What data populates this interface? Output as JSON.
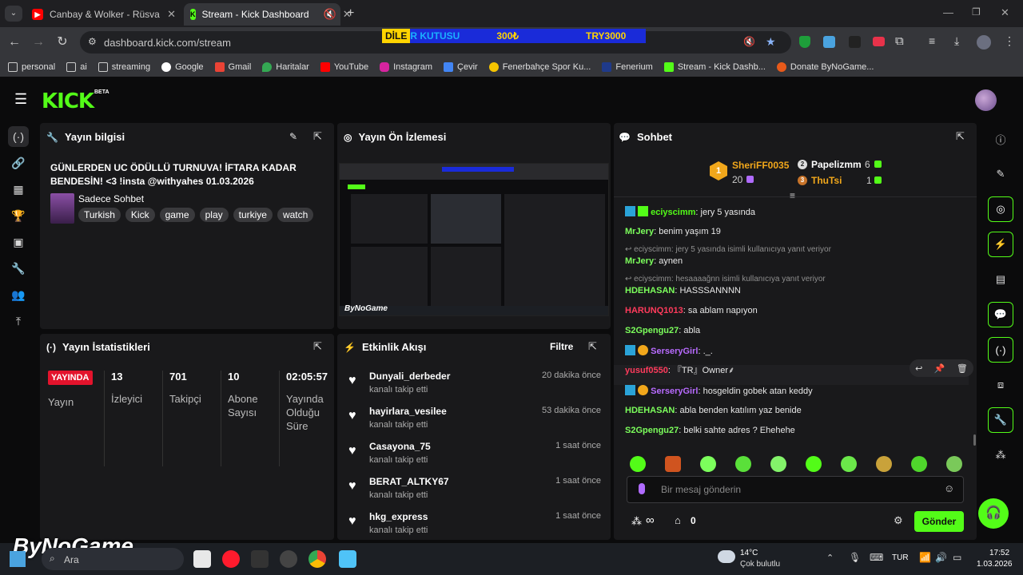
{
  "browser": {
    "tabs": [
      {
        "label": "Canbay & Wolker - Rüsva (Offic",
        "favicon_color": "#ff0000"
      },
      {
        "label": "Stream - Kick Dashboard",
        "favicon_color": "#53fc18"
      }
    ],
    "url": "dashboard.kick.com/stream",
    "banner": {
      "y_text": "DİLE",
      "rest": "R KUTUSU",
      "amount": "300₺",
      "currency": "TRY3000"
    },
    "bookmarks": [
      "personal",
      "ai",
      "streaming",
      "Google",
      "Gmail",
      "Haritalar",
      "YouTube",
      "Instagram",
      "Çevir",
      "Fenerbahçe Spor Ku...",
      "Fenerium",
      "Stream - Kick Dashb...",
      "Donate ByNoGame..."
    ]
  },
  "app": {
    "logo": "KICK",
    "beta": "BETA"
  },
  "stream_info": {
    "title": "Yayın bilgisi",
    "stream_title": "GÜNLERDEN UC ÖDÜLLÜ TURNUVA! İFTARA KADAR BENDESİN! <3 !insta @withyahes 01.03.2026",
    "category": "Sadece Sohbet",
    "tags": [
      "Turkish",
      "Kick",
      "game",
      "play",
      "turkiye",
      "watch"
    ]
  },
  "preview": {
    "title": "Yayın Ön İzlemesi",
    "watermark": "ByNoGame"
  },
  "chat": {
    "title": "Sohbet",
    "leaderboard": [
      {
        "rank": "1",
        "name": "SheriFF0035",
        "count": "20"
      },
      {
        "rank": "2",
        "name": "Papelizmm",
        "count": "6"
      },
      {
        "rank": "3",
        "name": "ThuTsi",
        "count": "1"
      }
    ],
    "messages": [
      {
        "user": "eciyscimm",
        "text": " jery 5 yasında",
        "color": "#53fc18",
        "reply": ""
      },
      {
        "user": "MrJery",
        "text": " benim yaşım 19",
        "color": "#7cff5c",
        "reply": ""
      },
      {
        "user": "MrJery",
        "text": " aynen",
        "color": "#7cff5c",
        "reply": "eciyscimm: jery 5 yasında isimli kullanıcıya yanıt veriyor"
      },
      {
        "user": "HDEHASAN",
        "text": " HASSSANNNN",
        "color": "#7cff5c",
        "reply": "eciyscimm: hesaaaağnn isimli kullanıcıya yanıt veriyor"
      },
      {
        "user": "HARUNQ1013",
        "text": " sa ablam napıyon",
        "color": "#ff3b5c",
        "reply": ""
      },
      {
        "user": "S2Gpengu27",
        "text": " abla",
        "color": "#7cff5c",
        "reply": ""
      },
      {
        "user": "SerseryGirl",
        "text": " ._.",
        "color": "#b86bff",
        "reply": ""
      },
      {
        "user": "yusuf0550",
        "text": " 『TR』Owner⸙",
        "color": "#ff3b5c",
        "reply": ""
      },
      {
        "user": "SerseryGirl",
        "text": " hosgeldin gobek atan keddy",
        "color": "#b86bff",
        "reply": ""
      },
      {
        "user": "HDEHASAN",
        "text": " abla benden katılım yaz benide",
        "color": "#7cff5c",
        "reply": ""
      },
      {
        "user": "S2Gpengu27",
        "text": " belki sahte adres ? Ehehehe",
        "color": "#7cff5c",
        "reply": ""
      }
    ],
    "input_placeholder": "Bir mesaj gönderin",
    "send_label": "Gönder",
    "gift_count": "0",
    "infinity": "∞"
  },
  "stats": {
    "title": "Yayın İstatistikleri",
    "live_badge": "YAYINDA",
    "live_label": "Yayın",
    "items": [
      {
        "value": "13",
        "label": "İzleyici"
      },
      {
        "value": "701",
        "label": "Takipçi"
      },
      {
        "value": "10",
        "label": "Abone Sayısı"
      },
      {
        "value": "02:05:57",
        "label": "Yayında Olduğu Süre"
      }
    ]
  },
  "activity": {
    "title": "Etkinlik Akışı",
    "filter": "Filtre",
    "events": [
      {
        "name": "Dunyali_derbeder",
        "sub": "kanalı takip etti",
        "time": "20 dakika önce"
      },
      {
        "name": "hayirlara_vesilee",
        "sub": "kanalı takip etti",
        "time": "53 dakika önce"
      },
      {
        "name": "Casayona_75",
        "sub": "kanalı takip etti",
        "time": "1 saat önce"
      },
      {
        "name": "BERAT_ALTKY67",
        "sub": "kanalı takip etti",
        "time": "1 saat önce"
      },
      {
        "name": "hkg_express",
        "sub": "kanalı takip etti",
        "time": "1 saat önce"
      }
    ]
  },
  "taskbar": {
    "search": "Ara",
    "weather_temp": "14°C",
    "weather_desc": "Çok bulutlu",
    "lang": "TUR",
    "time": "17:52",
    "date": "1.03.2026",
    "overlay_logo": "ByNoGame"
  },
  "colors": {
    "accent": "#53fc18",
    "live": "#e3132c",
    "panel": "#19191b"
  }
}
